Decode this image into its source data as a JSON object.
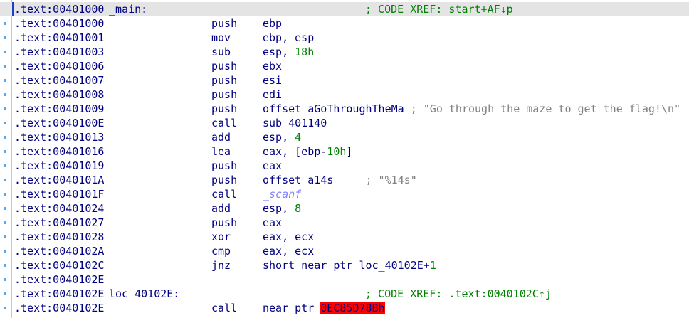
{
  "listing": {
    "rows": [
      {
        "addr": ".text:00401000",
        "label": "_main:",
        "mnem": "",
        "op": "",
        "op_num": "",
        "op_rest": "",
        "cmt": "",
        "xref": "; CODE XREF: start+AF↓p",
        "red": "",
        "ext": ""
      },
      {
        "addr": ".text:00401000",
        "label": "",
        "mnem": "push",
        "op": "ebp",
        "op_num": "",
        "op_rest": "",
        "cmt": "",
        "xref": "",
        "red": "",
        "ext": ""
      },
      {
        "addr": ".text:00401001",
        "label": "",
        "mnem": "mov",
        "op": "ebp, esp",
        "op_num": "",
        "op_rest": "",
        "cmt": "",
        "xref": "",
        "red": "",
        "ext": ""
      },
      {
        "addr": ".text:00401003",
        "label": "",
        "mnem": "sub",
        "op": "esp, ",
        "op_num": "18h",
        "op_rest": "",
        "cmt": "",
        "xref": "",
        "red": "",
        "ext": ""
      },
      {
        "addr": ".text:00401006",
        "label": "",
        "mnem": "push",
        "op": "ebx",
        "op_num": "",
        "op_rest": "",
        "cmt": "",
        "xref": "",
        "red": "",
        "ext": ""
      },
      {
        "addr": ".text:00401007",
        "label": "",
        "mnem": "push",
        "op": "esi",
        "op_num": "",
        "op_rest": "",
        "cmt": "",
        "xref": "",
        "red": "",
        "ext": ""
      },
      {
        "addr": ".text:00401008",
        "label": "",
        "mnem": "push",
        "op": "edi",
        "op_num": "",
        "op_rest": "",
        "cmt": "",
        "xref": "",
        "red": "",
        "ext": ""
      },
      {
        "addr": ".text:00401009",
        "label": "",
        "mnem": "push",
        "op": "offset aGoThroughTheMa",
        "op_num": "",
        "op_rest": "",
        "cmt": " ; \"Go through the maze to get the flag!\\n\"",
        "xref": "",
        "red": "",
        "ext": ""
      },
      {
        "addr": ".text:0040100E",
        "label": "",
        "mnem": "call",
        "op": "sub_401140",
        "op_num": "",
        "op_rest": "",
        "cmt": "",
        "xref": "",
        "red": "",
        "ext": ""
      },
      {
        "addr": ".text:00401013",
        "label": "",
        "mnem": "add",
        "op": "esp, ",
        "op_num": "4",
        "op_rest": "",
        "cmt": "",
        "xref": "",
        "red": "",
        "ext": ""
      },
      {
        "addr": ".text:00401016",
        "label": "",
        "mnem": "lea",
        "op": "eax, [ebp-",
        "op_num": "10h",
        "op_rest": "]",
        "cmt": "",
        "xref": "",
        "red": "",
        "ext": ""
      },
      {
        "addr": ".text:00401019",
        "label": "",
        "mnem": "push",
        "op": "eax",
        "op_num": "",
        "op_rest": "",
        "cmt": "",
        "xref": "",
        "red": "",
        "ext": ""
      },
      {
        "addr": ".text:0040101A",
        "label": "",
        "mnem": "push",
        "op": "offset a14s",
        "op_num": "",
        "op_rest": "",
        "cmt": "     ; \"%14s\"",
        "xref": "",
        "red": "",
        "ext": ""
      },
      {
        "addr": ".text:0040101F",
        "label": "",
        "mnem": "call",
        "op": "",
        "op_num": "",
        "op_rest": "",
        "cmt": "",
        "xref": "",
        "red": "",
        "ext": "_scanf"
      },
      {
        "addr": ".text:00401024",
        "label": "",
        "mnem": "add",
        "op": "esp, ",
        "op_num": "8",
        "op_rest": "",
        "cmt": "",
        "xref": "",
        "red": "",
        "ext": ""
      },
      {
        "addr": ".text:00401027",
        "label": "",
        "mnem": "push",
        "op": "eax",
        "op_num": "",
        "op_rest": "",
        "cmt": "",
        "xref": "",
        "red": "",
        "ext": ""
      },
      {
        "addr": ".text:00401028",
        "label": "",
        "mnem": "xor",
        "op": "eax, ecx",
        "op_num": "",
        "op_rest": "",
        "cmt": "",
        "xref": "",
        "red": "",
        "ext": ""
      },
      {
        "addr": ".text:0040102A",
        "label": "",
        "mnem": "cmp",
        "op": "eax, ecx",
        "op_num": "",
        "op_rest": "",
        "cmt": "",
        "xref": "",
        "red": "",
        "ext": ""
      },
      {
        "addr": ".text:0040102C",
        "label": "",
        "mnem": "jnz",
        "op": "short near ptr loc_40102E+",
        "op_num": "1",
        "op_rest": "",
        "cmt": "",
        "xref": "",
        "red": "",
        "ext": ""
      },
      {
        "addr": ".text:0040102E",
        "label": "",
        "mnem": "",
        "op": "",
        "op_num": "",
        "op_rest": "",
        "cmt": "",
        "xref": "",
        "red": "",
        "ext": ""
      },
      {
        "addr": ".text:0040102E",
        "label": "loc_40102E:",
        "mnem": "",
        "op": "",
        "op_num": "",
        "op_rest": "",
        "cmt": "",
        "xref": "; CODE XREF: .text:0040102C↑j",
        "red": "",
        "ext": ""
      },
      {
        "addr": ".text:0040102E",
        "label": "",
        "mnem": "call",
        "op": "near ptr ",
        "op_num": "",
        "op_rest": "",
        "cmt": "",
        "xref": "",
        "red": "0EC85D78Bh",
        "ext": ""
      }
    ]
  }
}
